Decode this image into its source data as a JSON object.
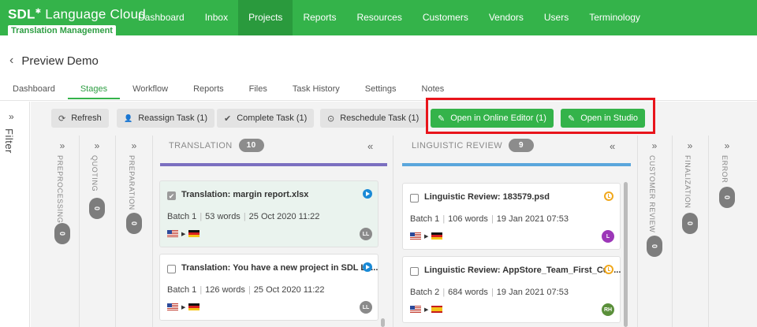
{
  "brand": {
    "name": "SDL",
    "name_rest": "Language Cloud",
    "badge": "Translation Management"
  },
  "nav": [
    "Dashboard",
    "Inbox",
    "Projects",
    "Reports",
    "Resources",
    "Customers",
    "Vendors",
    "Users",
    "Terminology"
  ],
  "nav_active": "Projects",
  "page": {
    "back_glyph": "‹",
    "title": "Preview Demo"
  },
  "tabs": [
    "Dashboard",
    "Stages",
    "Workflow",
    "Reports",
    "Files",
    "Task History",
    "Settings",
    "Notes"
  ],
  "tab_active": "Stages",
  "filter": {
    "glyph": "»",
    "label": "Filter"
  },
  "toolbar": {
    "refresh": {
      "icon": "⟳",
      "label": "Refresh"
    },
    "reassign": {
      "icon": "👤",
      "label": "Reassign Task (1)"
    },
    "complete": {
      "icon": "✔",
      "label": "Complete Task (1)"
    },
    "reschedule": {
      "icon": "⊙",
      "label": "Reschedule Task (1)"
    },
    "online_editor": {
      "icon": "✎",
      "label": "Open in Online Editor (1)"
    },
    "studio": {
      "icon": "✎",
      "label": "Open in Studio"
    }
  },
  "glyphs": {
    "expand": "»",
    "collapse": "«",
    "check": "✔",
    "arrow": "▶"
  },
  "collapsed_columns": {
    "preprocessing": {
      "label": "PREPROCESSING",
      "count": "0"
    },
    "quoting": {
      "label": "QUOTING",
      "count": "0"
    },
    "preparation": {
      "label": "PREPARATION",
      "count": "0"
    },
    "customer_review": {
      "label": "CUSTOMER REVIEW",
      "count": "0"
    },
    "finalization": {
      "label": "FINALIZATION",
      "count": "0"
    },
    "error": {
      "label": "ERROR",
      "count": "0"
    }
  },
  "translation": {
    "label": "TRANSLATION",
    "count": "10",
    "bar_color": "#7b6fc0",
    "cards": [
      {
        "title": "Translation: margin report.xlsx",
        "batch": "Batch 1",
        "words": "53 words",
        "date": "25 Oct 2020 11:22",
        "assignee": "LL"
      },
      {
        "title": "Translation: You have a new project in SDL La...",
        "batch": "Batch 1",
        "words": "126 words",
        "date": "25 Oct 2020 11:22",
        "assignee": "LL"
      }
    ]
  },
  "linguistic_review": {
    "label": "LINGUISTIC REVIEW",
    "count": "9",
    "bar_color": "#5aa6dc",
    "cards": [
      {
        "title": "Linguistic Review: 183579.psd",
        "batch": "Batch 1",
        "words": "106 words",
        "date": "19 Jan 2021 07:53",
        "assignee": "L"
      },
      {
        "title": "Linguistic Review: AppStore_Team_First_Cut ...",
        "batch": "Batch 2",
        "words": "684 words",
        "date": "19 Jan 2021 07:53",
        "assignee": "RH"
      }
    ]
  },
  "colors": {
    "brand_green": "#34b34a",
    "highlight_red": "#e8141b",
    "avatar_grey": "#8a8a8a",
    "avatar_purple": "#9c37b8",
    "avatar_green": "#5a8f3a"
  },
  "icons": {
    "status_in_progress": "play-circle-icon",
    "status_pending": "clock-icon",
    "source_flag": "us-flag-icon",
    "target_flag_de": "germany-flag-icon",
    "target_flag_es": "spain-flag-icon"
  }
}
